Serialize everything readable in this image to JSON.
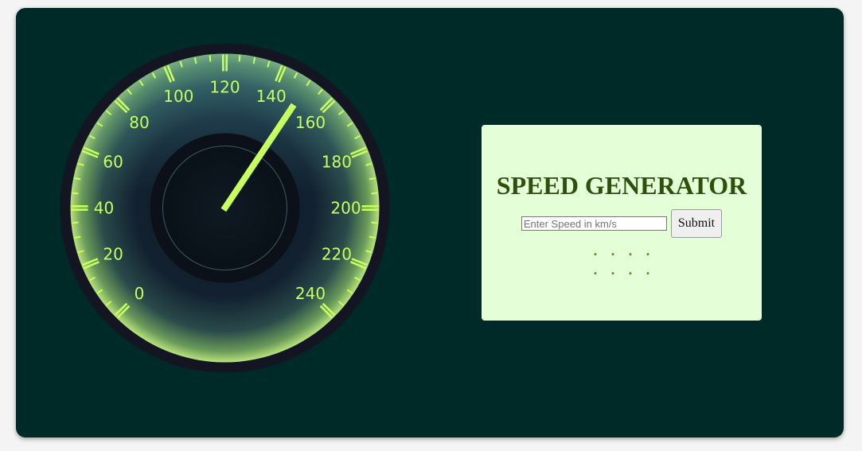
{
  "speedometer": {
    "current_speed": 150,
    "min_speed": 0,
    "max_speed": 240,
    "dial_labels": [
      "0",
      "20",
      "40",
      "60",
      "80",
      "100",
      "120",
      "140",
      "160",
      "180",
      "200",
      "220",
      "240"
    ],
    "accent_color": "#c6ff5e",
    "face_color": "#0b1620"
  },
  "panel": {
    "title": "SPEED GENERATOR",
    "input_placeholder": "Enter Speed in km/s",
    "input_value": "",
    "submit_label": "Submit",
    "output_line_1": ". . . .",
    "output_line_2": ". . . ."
  },
  "colors": {
    "app_background": "#002a27",
    "panel_background": "#e4fed8",
    "title_color": "#2f4f0c"
  }
}
